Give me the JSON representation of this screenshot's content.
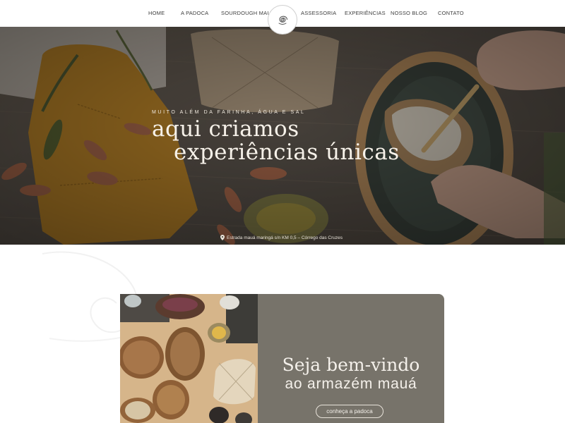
{
  "nav": {
    "items": [
      {
        "label": "HOME"
      },
      {
        "label": "A PADOCA"
      },
      {
        "label": "SOURDOUGH MAUÁ"
      },
      {
        "label": "ASSESSORIA"
      },
      {
        "label": "EXPERIÊNCIAS"
      },
      {
        "label": "NOSSO BLOG"
      },
      {
        "label": "CONTATO"
      }
    ],
    "logo_icon": "swirl-logo-icon"
  },
  "hero": {
    "kicker": "MUITO ALÉM DA FARINHA, ÁGUA E SAL",
    "title_line1": "aqui criamos",
    "title_line2": "experiências únicas",
    "address": "Estrada mauá maringá s/n KM 0,5 – Córrego das Cruzes",
    "address_icon": "map-pin-icon"
  },
  "welcome": {
    "title_line1": "Seja bem-vindo",
    "title_line2": "ao armazém mauá",
    "button_label": "conheça a padoca"
  },
  "colors": {
    "card_bg": "#77736a",
    "hero_text": "#f6f1e9",
    "nav_text": "#3d3d3d",
    "mustard": "#c98a1e"
  }
}
